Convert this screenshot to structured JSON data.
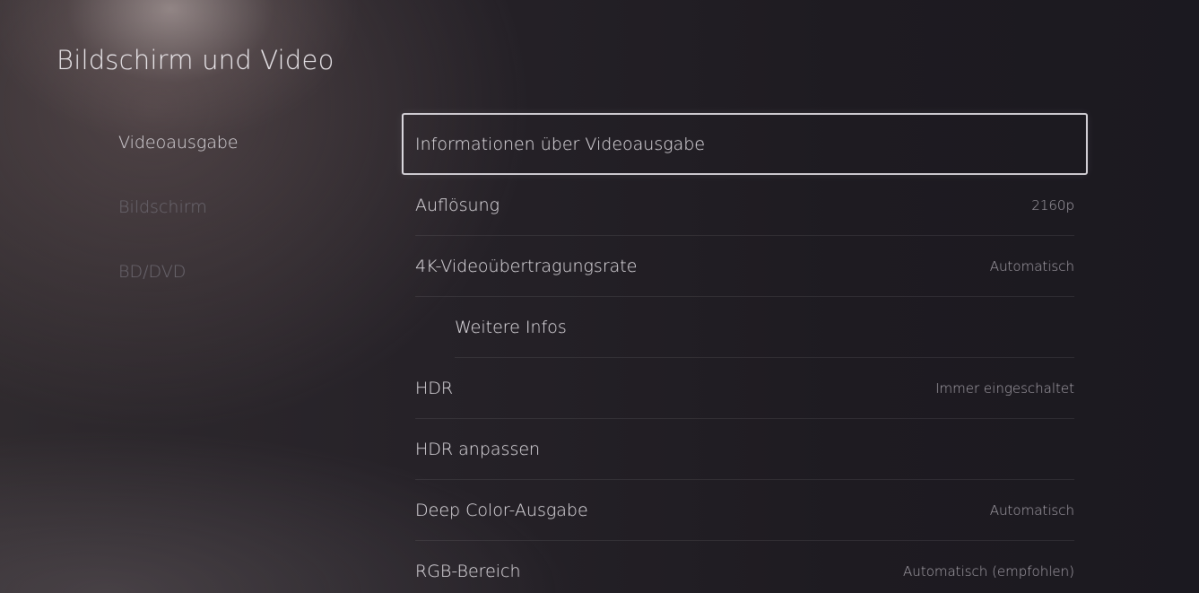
{
  "page": {
    "title": "Bildschirm und Video"
  },
  "sidebar": {
    "items": [
      {
        "label": "Videoausgabe",
        "active": true
      },
      {
        "label": "Bildschirm",
        "active": false
      },
      {
        "label": "BD/DVD",
        "active": false
      }
    ]
  },
  "settings": {
    "rows": [
      {
        "label": "Informationen über Videoausgabe",
        "value": ""
      },
      {
        "label": "Auflösung",
        "value": "2160p"
      },
      {
        "label": "4K-Videoübertragungsrate",
        "value": "Automatisch"
      },
      {
        "label": "Weitere Infos",
        "value": ""
      },
      {
        "label": "HDR",
        "value": "Immer eingeschaltet"
      },
      {
        "label": "HDR anpassen",
        "value": ""
      },
      {
        "label": "Deep Color-Ausgabe",
        "value": "Automatisch"
      },
      {
        "label": "RGB-Bereich",
        "value": "Automatisch (empfohlen)"
      }
    ]
  },
  "colors": {
    "focus_border": "#d9d6dc",
    "inactive_text": "#6c6870",
    "value_text": "#a9a5ad"
  }
}
